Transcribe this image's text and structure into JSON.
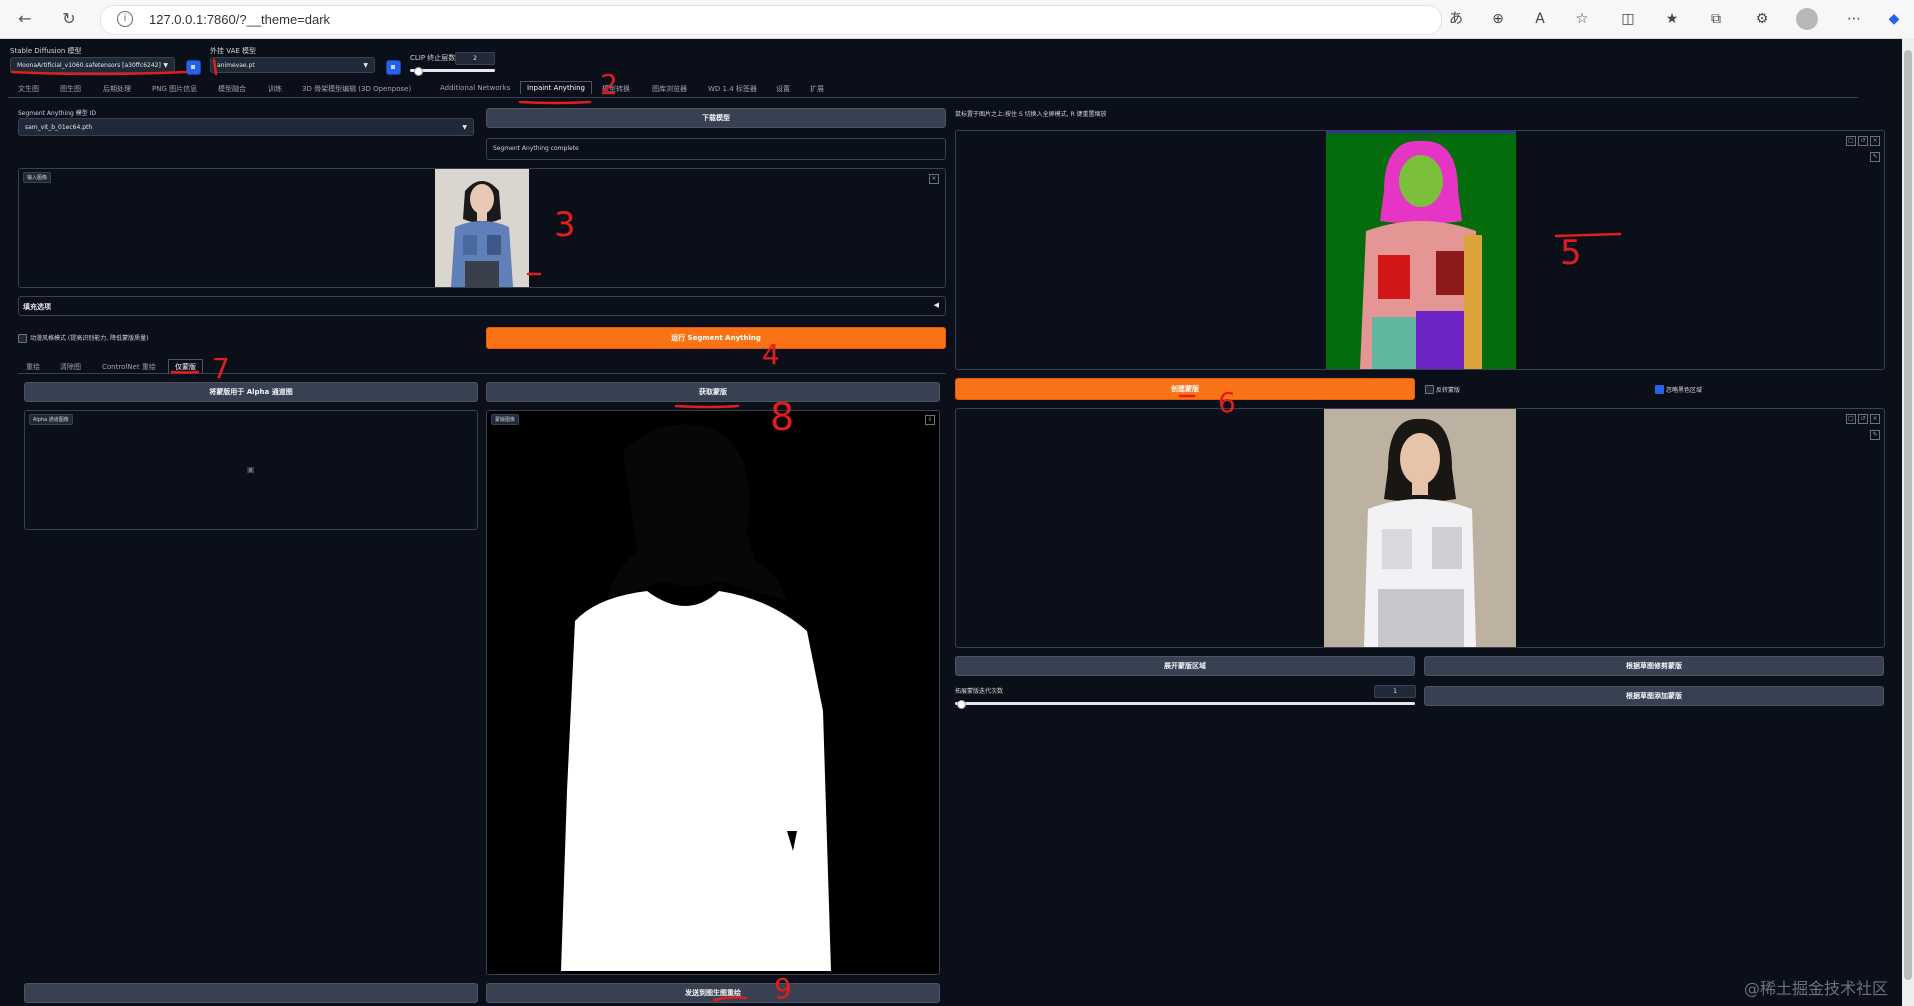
{
  "browser": {
    "url": "127.0.0.1:7860/?__theme=dark"
  },
  "header": {
    "sd_model_label": "Stable Diffusion 模型",
    "sd_model_value": "MoonaArtificial_v1060.safetensors [a30ffc6242]",
    "vae_label": "外挂 VAE 模型",
    "vae_value": "animevae.pt",
    "clip_label": "CLIP 终止层数",
    "clip_value": "2"
  },
  "tabs": [
    "文生图",
    "图生图",
    "后期处理",
    "PNG 图片信息",
    "模型融合",
    "训练",
    "3D 骨架模型编辑 (3D Openpose)",
    "Additional Networks",
    "Inpaint Anything",
    "模型转换",
    "图库浏览器",
    "WD 1.4 标签器",
    "设置",
    "扩展"
  ],
  "left": {
    "sam_model_label": "Segment Anything 模型 ID",
    "sam_model_value": "sam_vit_b_01ec64.pth",
    "download_btn": "下载模型",
    "status_text": "Segment Anything complete",
    "input_image_tag": "输入图像",
    "fill_options": "填充选项",
    "anime_mode": "动漫风格模式 (提高识别能力, 降低蒙版质量)",
    "run_sam_btn": "运行 Segment Anything",
    "sub_tabs": [
      "重绘",
      "清除图",
      "ControlNet 重绘",
      "仅蒙版"
    ],
    "alpha_btn": "将蒙版用于 Alpha 通道图",
    "get_mask_btn": "获取蒙版",
    "alpha_tag": "Alpha 通道图像",
    "mask_tag": "蒙版图像",
    "send_btn": "发送到图生图重绘"
  },
  "right": {
    "hint_text": "鼠标置于图片之上:按住 S 切换入全屏模式, R 键重置缩放",
    "create_mask_btn": "创建蒙版",
    "invert_label": "反转蒙版",
    "ignore_black_label": "忽略黑色区域",
    "expand_btn": "展开蒙版区域",
    "trim_btn": "根据草图修剪蒙版",
    "add_btn": "根据草图添加蒙版",
    "iter_label": "拓展蒙版迭代次数",
    "iter_value": "1"
  },
  "annotations": [
    "1",
    "2",
    "3",
    "4",
    "5",
    "6",
    "7",
    "8",
    "9"
  ],
  "watermark": "@稀土掘金技术社区"
}
